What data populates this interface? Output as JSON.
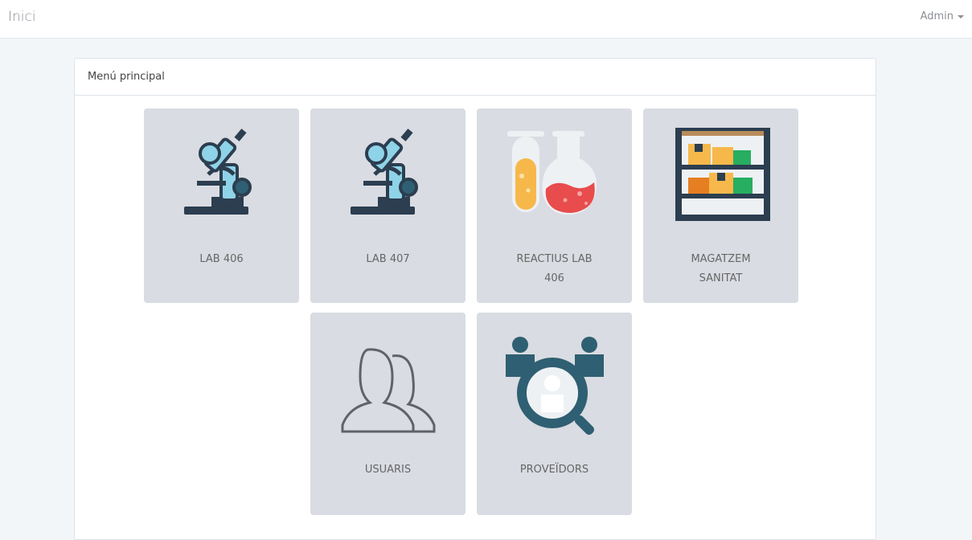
{
  "navbar": {
    "brand": "Inici",
    "user_menu": "Admin"
  },
  "panel": {
    "title": "Menú principal"
  },
  "tiles": [
    {
      "icon": "microscope-icon",
      "label_lines": [
        "LAB 406"
      ]
    },
    {
      "icon": "microscope-icon",
      "label_lines": [
        "LAB 407"
      ]
    },
    {
      "icon": "lab-flasks-icon",
      "label_lines": [
        "REACTIUS LAB",
        "406"
      ]
    },
    {
      "icon": "storage-shelf-icon",
      "label_lines": [
        "MAGATZEM",
        "SANITAT"
      ]
    },
    {
      "icon": "users-icon",
      "label_lines": [
        "USUARIS"
      ]
    },
    {
      "icon": "supplier-search-icon",
      "label_lines": [
        "PROVEÏDORS"
      ]
    }
  ],
  "colors": {
    "tile_bg": "#d9dce2",
    "icon_dark": "#2c3e50",
    "icon_light_blue": "#8fd3e8",
    "icon_teal": "#2f5f72"
  }
}
